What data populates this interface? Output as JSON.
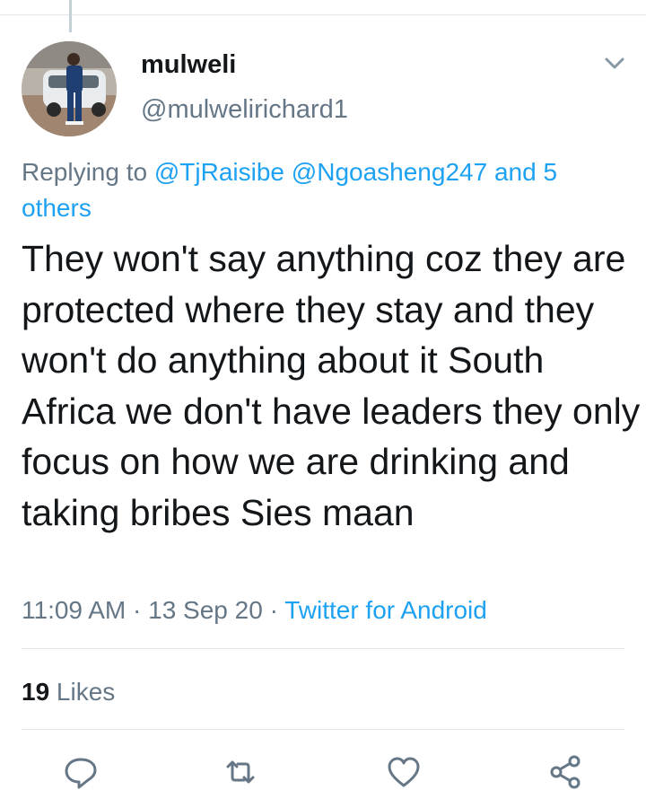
{
  "tweet": {
    "display_name": "mulweli",
    "handle": "@mulwelirichard1",
    "replying_prefix": "Replying to ",
    "replying_users": [
      "@TjRaisibe",
      "@Ngoasheng247"
    ],
    "replying_and": " and ",
    "replying_others": "5 others",
    "text": "They won't say anything coz they are protected where they stay and they won't do anything about it South Africa we don't have leaders they only focus on how we are drinking and taking bribes Sies maan",
    "time": "11:09 AM",
    "separator": " · ",
    "date": "13 Sep 20",
    "source": "Twitter for Android",
    "likes_count": "19",
    "likes_label": " Likes"
  },
  "icons": {
    "menu": "chevron-down-icon",
    "reply": "reply-icon",
    "retweet": "retweet-icon",
    "like": "heart-icon",
    "share": "share-icon"
  },
  "colors": {
    "link": "#1da1f2",
    "secondary_text": "#657786",
    "primary_text": "#14171a",
    "divider": "#e1e8ed"
  }
}
